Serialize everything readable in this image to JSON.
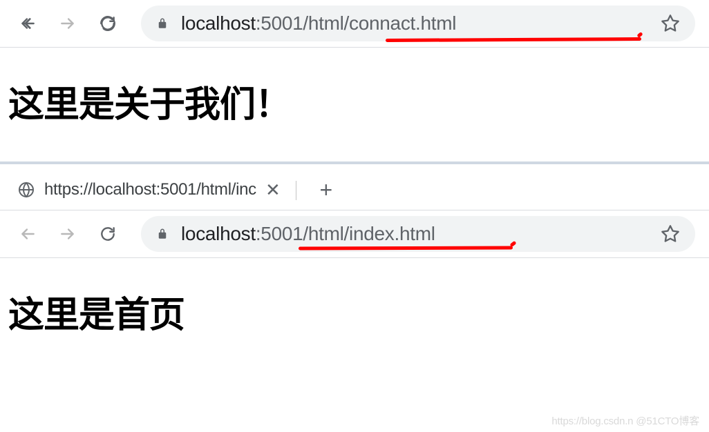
{
  "browser1": {
    "url_host": "localhost",
    "url_path": ":5001/html/connact.html",
    "page_heading": "这里是关于我们！"
  },
  "browser2": {
    "tab_title": "https://localhost:5001/html/inc",
    "url_host": "localhost",
    "url_path": ":5001/html/index.html",
    "page_heading": "这里是首页"
  },
  "watermark": "https://blog.csdn.n @51CTO博客"
}
